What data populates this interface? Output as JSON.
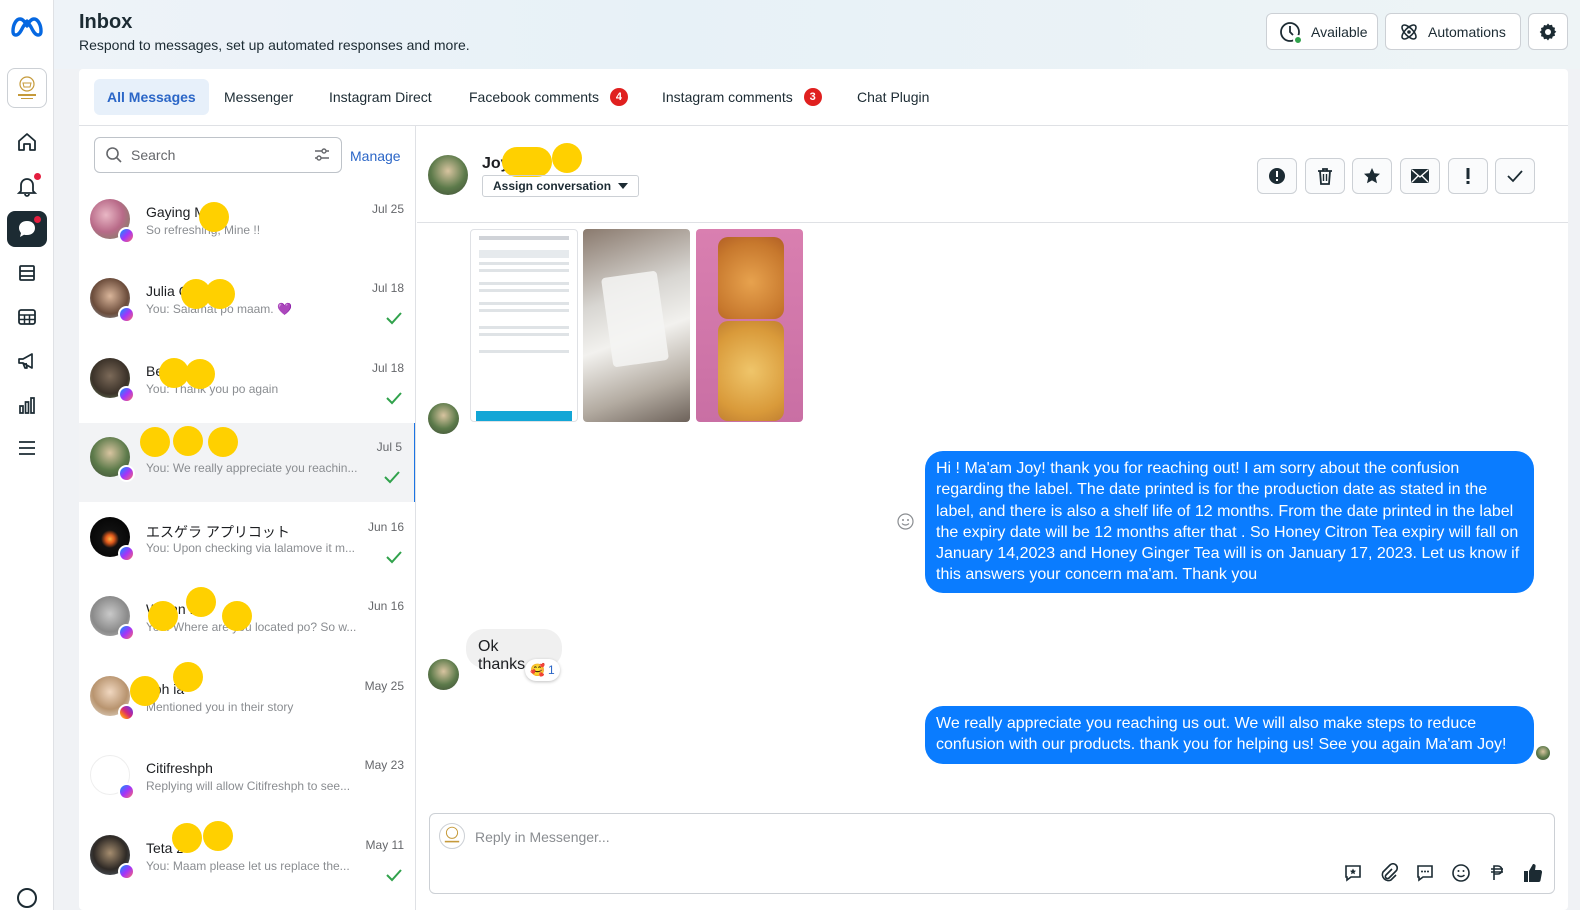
{
  "header": {
    "title": "Inbox",
    "subtitle": "Respond to messages, set up automated responses and more.",
    "available_label": "Available",
    "automations_label": "Automations"
  },
  "tabs": [
    {
      "label": "All Messages"
    },
    {
      "label": "Messenger"
    },
    {
      "label": "Instagram Direct"
    },
    {
      "label": "Facebook comments",
      "count": "4"
    },
    {
      "label": "Instagram comments",
      "count": "3"
    },
    {
      "label": "Chat Plugin"
    }
  ],
  "search": {
    "placeholder": "Search",
    "manage_label": "Manage"
  },
  "conversations": [
    {
      "name": "Gaying M    es",
      "snippet": "So refreshing, Mine !!",
      "date": "Jul 25",
      "channel": "messenger"
    },
    {
      "name": "Julia C",
      "snippet": "You: Salamat po maam. 💜",
      "date": "Jul 18",
      "channel": "messenger",
      "replied": true
    },
    {
      "name": "Be",
      "snippet": "You: Thank you po again",
      "date": "Jul 18",
      "channel": "messenger",
      "replied": true
    },
    {
      "name": "    er",
      "snippet": "You: We really appreciate you reachin...",
      "date": "Jul 5",
      "channel": "messenger",
      "replied": true,
      "selected": true
    },
    {
      "name": "エスゲラ アプリコット",
      "snippet": "You: Upon checking via lalamove it m...",
      "date": "Jun 16",
      "channel": "messenger",
      "replied": true
    },
    {
      "name": "W  ynn Ka",
      "snippet": "You: Where are you located po? So w...",
      "date": "Jun 16",
      "channel": "messenger"
    },
    {
      "name": "  eph   ia",
      "snippet": "Mentioned you in their story",
      "date": "May 25",
      "channel": "instagram"
    },
    {
      "name": "Citifreshph",
      "snippet": "Replying will allow Citifreshph to see...",
      "date": "May 23",
      "channel": "messenger"
    },
    {
      "name": "Teta      z",
      "snippet": "You: Maam please let us replace the...",
      "date": "May 11",
      "channel": "messenger",
      "replied": true
    }
  ],
  "chat": {
    "contact_name": "Joy",
    "assign_label": "Assign conversation",
    "messages": [
      {
        "from": "customer",
        "type": "images",
        "count": 3
      },
      {
        "from": "page",
        "text": "Hi ! Ma'am Joy! thank you for reaching out!  I am sorry about the confusion regarding the label. The date printed is for the production date as stated in the label, and there is also a shelf life of 12 months. From the date printed in the label the expiry date will be 12 months after that . So Honey Citron Tea expiry will fall on January 14,2023 and Honey Ginger Tea will is on January 17, 2023. Let us know if this answers your concern ma'am. Thank you"
      },
      {
        "from": "customer",
        "text": "Ok thanks",
        "reaction": "🥰",
        "reaction_count": "1"
      },
      {
        "from": "page",
        "text": "We really appreciate you reaching us out. We will also make steps to reduce confusion with our products. thank you for helping us! See you again Ma'am Joy!"
      }
    ],
    "reply_placeholder": "Reply in Messenger..."
  },
  "colors": {
    "accent": "#1b74e4",
    "bubble_out": "#0a7cff",
    "badge": "#e0201f",
    "highlight_blob": "#ffd000"
  }
}
